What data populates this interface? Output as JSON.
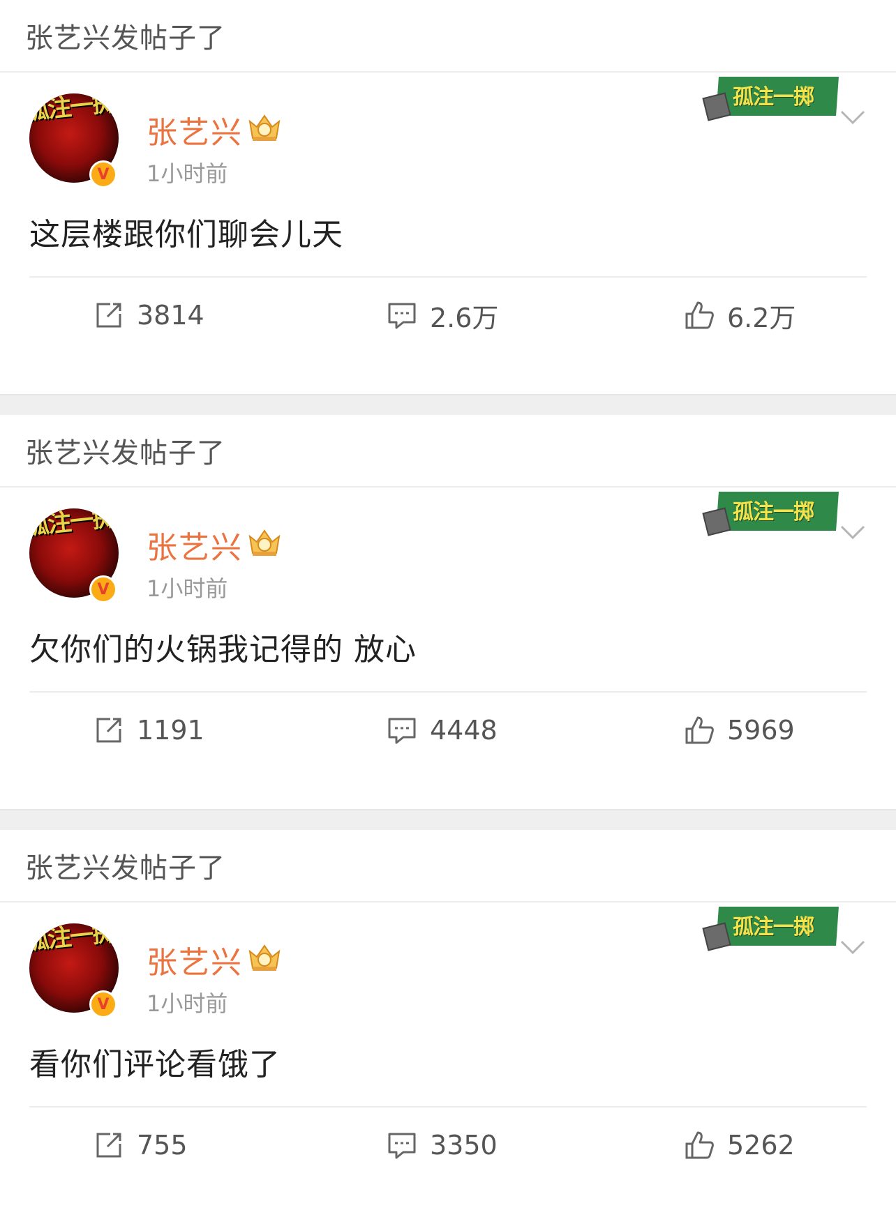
{
  "posts": [
    {
      "section_title": "张艺兴发帖子了",
      "avatar_art_text": "孤注一掷",
      "badge_text": "孤注一掷",
      "username": "张艺兴",
      "timestamp": "1小时前",
      "text": "这层楼跟你们聊会儿天",
      "reposts": "3814",
      "comments": "2.6万",
      "likes": "6.2万"
    },
    {
      "section_title": "张艺兴发帖子了",
      "avatar_art_text": "孤注一掷",
      "badge_text": "孤注一掷",
      "username": "张艺兴",
      "timestamp": "1小时前",
      "text": "欠你们的火锅我记得的 放心",
      "reposts": "1191",
      "comments": "4448",
      "likes": "5969"
    },
    {
      "section_title": "张艺兴发帖子了",
      "avatar_art_text": "孤注一掷",
      "badge_text": "孤注一掷",
      "username": "张艺兴",
      "timestamp": "1小时前",
      "text": "看你们评论看饿了",
      "reposts": "755",
      "comments": "3350",
      "likes": "5262"
    }
  ],
  "icons": {
    "repost": "repost-icon",
    "comment": "comment-icon",
    "like": "like-icon",
    "verified": "verified-badge-icon",
    "vip": "vip-crown-icon",
    "menu": "chevron-down-icon"
  },
  "verified_mark": "V",
  "colors": {
    "username": "#eb7340",
    "verified": "#fbab15",
    "badge_green": "#2f8a4a",
    "badge_text": "#f3e24a"
  }
}
